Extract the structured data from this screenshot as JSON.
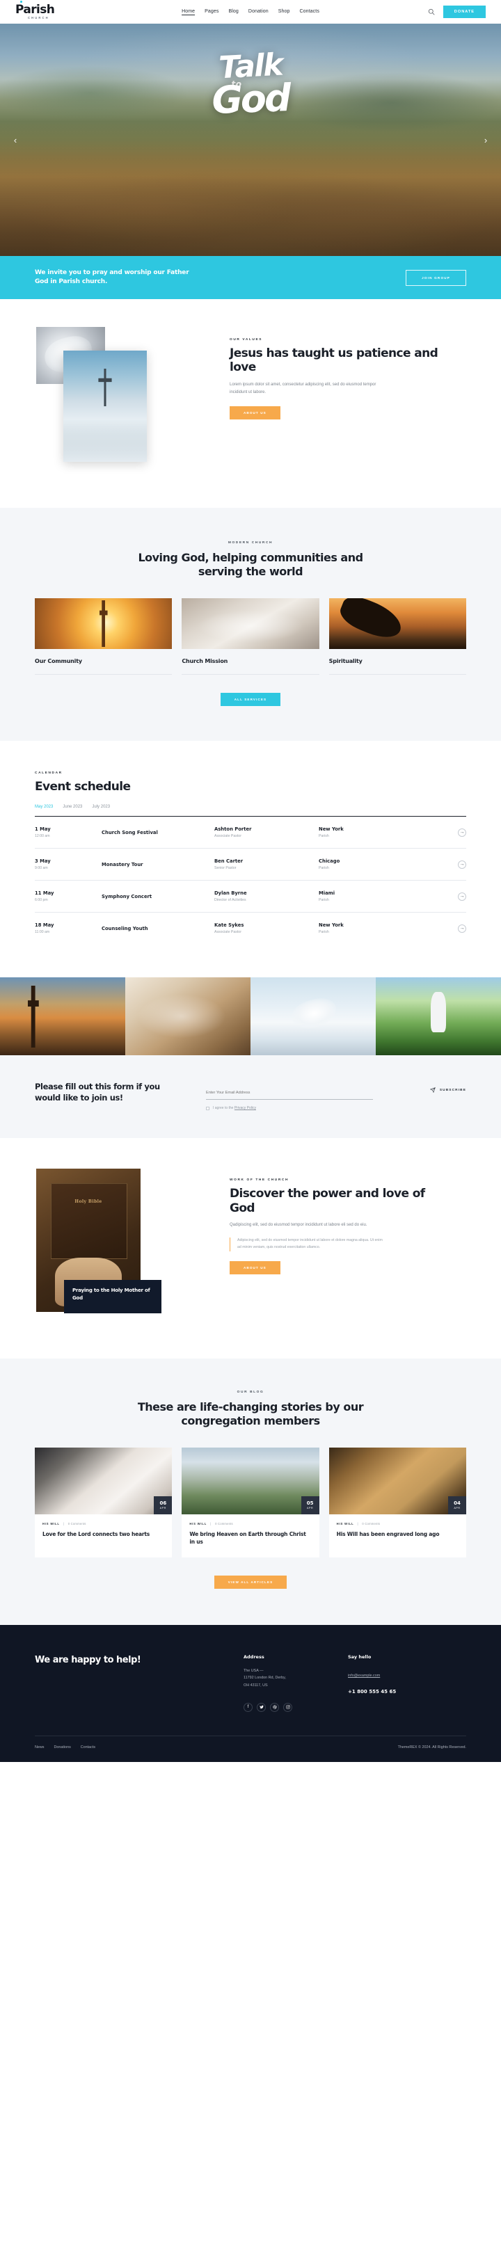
{
  "header": {
    "logo_word": "Parish",
    "logo_sub": "CHURCH",
    "nav": [
      {
        "label": "Home",
        "active": true
      },
      {
        "label": "Pages",
        "active": false
      },
      {
        "label": "Blog",
        "active": false
      },
      {
        "label": "Donation",
        "active": false
      },
      {
        "label": "Shop",
        "active": false
      },
      {
        "label": "Contacts",
        "active": false
      }
    ],
    "search_icon": "search-icon",
    "donate_label": "DONATE"
  },
  "hero": {
    "line1": "Talk",
    "line2": "to",
    "line3": "God",
    "prev_icon": "chevron-left-icon",
    "next_icon": "chevron-right-icon"
  },
  "cta": {
    "line1": "We invite you to pray and worship our Father",
    "line2": "God in Parish church.",
    "button": "JOIN GROUP",
    "color": "#2ec7e0"
  },
  "values": {
    "eyebrow": "OUR VALUES",
    "title": "Jesus has taught us patience and love",
    "text": "Lorem ipsum dolor sit amet, consectetur adipiscing elit, sed do eiusmod tempor incididunt ut labore.",
    "button": "ABOUT US",
    "button_color": "#f7a94b"
  },
  "services": {
    "eyebrow": "MODERN CHURCH",
    "title": "Loving God, helping communities and serving the world",
    "cards": [
      {
        "title": "Our Community"
      },
      {
        "title": "Church Mission"
      },
      {
        "title": "Spirituality"
      }
    ],
    "button": "ALL SERVICES"
  },
  "calendar": {
    "eyebrow": "CALENDAR",
    "title": "Event schedule",
    "tabs": [
      {
        "label": "May 2023",
        "active": true
      },
      {
        "label": "June 2023",
        "active": false
      },
      {
        "label": "July 2023",
        "active": false
      }
    ],
    "rows": [
      {
        "date": "1 May",
        "time": "12:00 am",
        "event": "Church Song Festival",
        "person": "Ashton Porter",
        "role": "Associate Pastor",
        "city": "New York",
        "venue": "Parish",
        "arrow": "arrow-right-icon"
      },
      {
        "date": "3 May",
        "time": "9:00 am",
        "event": "Monastery Tour",
        "person": "Ben Carter",
        "role": "Senior Pastor",
        "city": "Chicago",
        "venue": "Parish",
        "arrow": "arrow-right-icon"
      },
      {
        "date": "11 May",
        "time": "6:00 pm",
        "event": "Symphony Concert",
        "person": "Dylan Byrne",
        "role": "Director of Activities",
        "city": "Miami",
        "venue": "Parish",
        "arrow": "arrow-right-icon"
      },
      {
        "date": "18 May",
        "time": "11:00 am",
        "event": "Counseling Youth",
        "person": "Kate Sykes",
        "role": "Associate Pastor",
        "city": "New York",
        "venue": "Parish",
        "arrow": "arrow-right-icon"
      }
    ]
  },
  "subscribe": {
    "title": "Please fill out this form if you would like to join us!",
    "placeholder": "Enter Your Email Address",
    "value": "",
    "agree_prefix": "I agree to the ",
    "agree_link": "Privacy Policy",
    "button": "SUBSCRIBE",
    "button_icon": "paper-plane-icon"
  },
  "work": {
    "eyebrow": "WORK OF THE CHURCH",
    "title": "Discover the power and love of God",
    "text": "Qadipiscing elit, sed do eiusmod tempor incididunt ut labore eli sed do eiu.",
    "quote": "Adipiscing elit, sed do eiusmod tempor incididunt ut labore et dolore magna aliqua. Ut enim ad minim veniam, quis nostrud exercitation ullamco.",
    "button": "ABOUT US",
    "bible_word": "Holy Bible",
    "overlay_card": "Praying to the Holy Mother of God"
  },
  "blog": {
    "eyebrow": "OUR BLOG",
    "title": "These are life-changing stories by our congregation members",
    "posts": [
      {
        "day": "06",
        "month": "APR",
        "category": "HIS WILL",
        "comments": "0 Comments",
        "title": "Love for the Lord connects two hearts"
      },
      {
        "day": "05",
        "month": "APR",
        "category": "HIS WILL",
        "comments": "0 Comments",
        "title": "We bring Heaven on Earth through Christ in us"
      },
      {
        "day": "04",
        "month": "APR",
        "category": "HIS WILL",
        "comments": "0 Comments",
        "title": "His Will has been engraved long ago"
      }
    ],
    "button": "VIEW ALL ARTICLES"
  },
  "footer": {
    "heading": "We are happy to help!",
    "address_title": "Address",
    "address_line1": "The USA  —",
    "address_line2": "11792 London Rd, Derby,",
    "address_line3": "OH 43117, US",
    "contact_title": "Say hello",
    "email": "info@example.com",
    "phone": "+1 800 555 45 65",
    "socials": [
      {
        "name": "facebook-icon",
        "glyph": "f"
      },
      {
        "name": "twitter-icon",
        "glyph": "🐦"
      },
      {
        "name": "dribbble-icon",
        "glyph": "◍"
      },
      {
        "name": "instagram-icon",
        "glyph": "◲"
      }
    ],
    "links": [
      {
        "label": "News"
      },
      {
        "label": "Donations"
      },
      {
        "label": "Contacts"
      }
    ],
    "copyright": "ThemeREX © 2024. All Rights Reserved."
  }
}
